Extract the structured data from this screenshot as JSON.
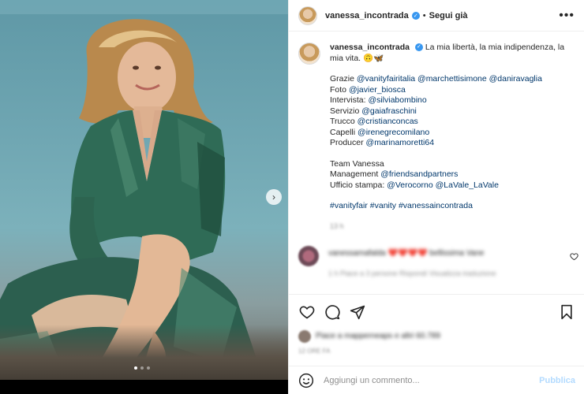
{
  "colors": {
    "link": "#00376b",
    "verified": "#3897f0",
    "publish": "#b3dbff",
    "muted": "#8e8e8e"
  },
  "header": {
    "username": "vanessa_incontrada",
    "separator": "•",
    "follow_label": "Segui già",
    "more_icon": "more-horizontal-icon"
  },
  "caption": {
    "username": "vanessa_incontrada",
    "text": "La mia libertà, la mia indipendenza, la mia vita. 🙃🦋",
    "credits": [
      {
        "label": "Grazie ",
        "tags": "@vanityfairitalia @marchettisimone @daniravaglia"
      },
      {
        "label": "Foto ",
        "tags": "@javier_biosca"
      },
      {
        "label": "Intervista: ",
        "tags": "@silviabombino"
      },
      {
        "label": "Servizio ",
        "tags": "@gaiafraschini"
      },
      {
        "label": "Trucco ",
        "tags": "@cristianconcas"
      },
      {
        "label": "Capelli ",
        "tags": "@irenegrecomilano"
      },
      {
        "label": "Producer ",
        "tags": "@marinamoretti64"
      }
    ],
    "team_title": "Team Vanessa",
    "team": [
      {
        "label": "Management ",
        "tags": "@friendsandpartners"
      },
      {
        "label": "Ufficio stampa: ",
        "tags": "@Verocorno @LaVale_LaVale"
      }
    ],
    "hashtags": "#vanityfair #vanity #vanessaincontrada",
    "time_ago": "13 h"
  },
  "comment": {
    "text": "vanessamafalda ❤️❤️❤️❤️ bellissima Vane",
    "meta": "1 h   Piace a 3 persone   Rispondi   Visualizza traduzione",
    "like_icon": "heart-outline-icon"
  },
  "actions": {
    "like_icon": "heart-outline-icon",
    "comment_icon": "comment-icon",
    "share_icon": "paper-plane-icon",
    "save_icon": "bookmark-icon"
  },
  "likes": {
    "text": "Piace a mapperneaps e altri 60.789",
    "date": "12 ORE FA"
  },
  "composer": {
    "emoji_icon": "emoji-icon",
    "placeholder": "Aggiungi un commento...",
    "publish_label": "Pubblica"
  },
  "carousel": {
    "next_icon": "chevron-right-icon",
    "total": 3,
    "current": 1
  }
}
